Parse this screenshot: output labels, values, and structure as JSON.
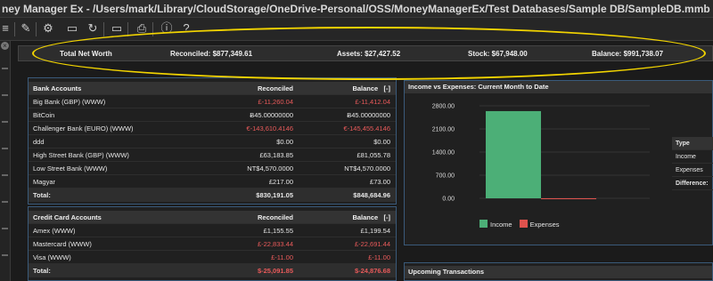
{
  "window": {
    "title": "ney Manager Ex - /Users/mark/Library/CloudStorage/OneDrive-Personal/OSS/MoneyManagerEx/Test Databases/Sample DB/SampleDB.mmb"
  },
  "toolbar": {
    "icons": [
      "checklist-icon",
      "edit-icon",
      "gear-icon",
      "comment-icon",
      "refresh-icon",
      "monitor-icon",
      "printer-icon",
      "info-icon",
      "help-icon"
    ]
  },
  "networth": {
    "label": "Total Net Worth",
    "reconciled": "Reconciled: $877,349.61",
    "assets": "Assets: $27,427.52",
    "stock": "Stock: $67,948.00",
    "balance": "Balance: $991,738.07"
  },
  "bank_accounts": {
    "header": "Bank Accounts",
    "col_reconciled": "Reconciled",
    "col_balance": "Balance",
    "toggle": "[-]",
    "rows": [
      {
        "name": "Big Bank (GBP)   (WWW)",
        "reconciled": "£-11,260.04",
        "balance": "£-11,412.04",
        "rec_neg": true,
        "bal_neg": true
      },
      {
        "name": "BitCoin",
        "reconciled": "Ƀ45.00000000",
        "balance": "Ƀ45.00000000",
        "rec_neg": false,
        "bal_neg": false
      },
      {
        "name": "Challenger Bank (EURO)   (WWW)",
        "reconciled": "€-143,610.4146",
        "balance": "€-145,455.4146",
        "rec_neg": true,
        "bal_neg": true
      },
      {
        "name": "ddd",
        "reconciled": "$0.00",
        "balance": "$0.00",
        "rec_neg": false,
        "bal_neg": false
      },
      {
        "name": "High Street Bank (GBP)   (WWW)",
        "reconciled": "£63,183.85",
        "balance": "£81,055.78",
        "rec_neg": false,
        "bal_neg": false
      },
      {
        "name": "Low Street Bank   (WWW)",
        "reconciled": "NT$4,570.0000",
        "balance": "NT$4,570.0000",
        "rec_neg": false,
        "bal_neg": false
      },
      {
        "name": "Magyar",
        "reconciled": "£217.00",
        "balance": "£73.00",
        "rec_neg": false,
        "bal_neg": false
      }
    ],
    "total_label": "Total:",
    "total_reconciled": "$830,191.05",
    "total_balance": "$848,684.96"
  },
  "credit_accounts": {
    "header": "Credit Card Accounts",
    "col_reconciled": "Reconciled",
    "col_balance": "Balance",
    "toggle": "[-]",
    "rows": [
      {
        "name": "Amex   (WWW)",
        "reconciled": "£1,155.55",
        "balance": "£1,199.54",
        "rec_neg": false,
        "bal_neg": false
      },
      {
        "name": "Mastercard   (WWW)",
        "reconciled": "£-22,833.44",
        "balance": "£-22,691.44",
        "rec_neg": true,
        "bal_neg": true
      },
      {
        "name": "Visa   (WWW)",
        "reconciled": "£-11.00",
        "balance": "£-11.00",
        "rec_neg": true,
        "bal_neg": true
      }
    ],
    "total_label": "Total:",
    "total_reconciled": "$-25,091.85",
    "total_balance": "$-24,876.68"
  },
  "income_panel": {
    "title": "Income vs Expenses: Current Month to Date"
  },
  "chart_data": {
    "type": "bar",
    "categories": [
      ""
    ],
    "series": [
      {
        "name": "Income",
        "values": [
          2640
        ],
        "color": "#4caf77"
      },
      {
        "name": "Expenses",
        "values": [
          0
        ],
        "color": "#e0524d"
      }
    ],
    "yticks": [
      "2800.00",
      "2100.00",
      "1400.00",
      "700.00",
      "0.00"
    ],
    "ylim": [
      0,
      2800
    ],
    "grid": true,
    "legend": "bottom"
  },
  "summary": {
    "type_label": "Type",
    "income_label": "Income",
    "income_value": "$",
    "expenses_label": "Expenses",
    "expenses_value": "$",
    "difference_label": "Difference:",
    "difference_value": "$"
  },
  "upcoming": {
    "title": "Upcoming Transactions"
  }
}
